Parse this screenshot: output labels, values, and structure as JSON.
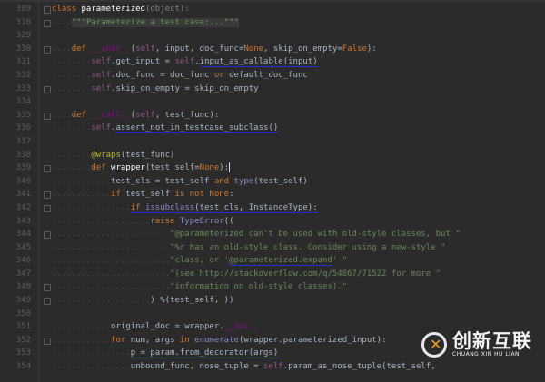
{
  "editor": {
    "lines": [
      {
        "n": "309",
        "indent": 0,
        "fold": true,
        "tokens": [
          [
            "k",
            "class "
          ],
          [
            "fn",
            "parameterized"
          ],
          [
            "c",
            "(object):"
          ]
        ]
      },
      {
        "n": "310",
        "indent": 4,
        "fold": true,
        "tokens": [
          [
            "doc",
            "\"\"\"Parameterize a test case:...\"\"\""
          ]
        ]
      },
      {
        "n": "329",
        "indent": 0,
        "tokens": []
      },
      {
        "n": "330",
        "indent": 4,
        "fold": true,
        "tokens": [
          [
            "k",
            "def "
          ],
          [
            "m",
            "__init__"
          ],
          [
            "n",
            "("
          ],
          [
            "s",
            "self"
          ],
          [
            "n",
            ", input, doc_func="
          ],
          [
            "k",
            "None"
          ],
          [
            "n",
            ", skip_on_empty="
          ],
          [
            "k",
            "False"
          ],
          [
            "n",
            "):"
          ]
        ]
      },
      {
        "n": "331",
        "indent": 8,
        "tokens": [
          [
            "s",
            "self"
          ],
          [
            "n",
            ".get_input = "
          ],
          [
            "s",
            "self"
          ],
          [
            "n",
            "."
          ],
          [
            "n ul",
            "input_as_callable(input)"
          ]
        ]
      },
      {
        "n": "332",
        "indent": 8,
        "tokens": [
          [
            "s",
            "self"
          ],
          [
            "n",
            ".doc_func = doc_func "
          ],
          [
            "k",
            "or"
          ],
          [
            "n",
            " default_doc_func"
          ]
        ]
      },
      {
        "n": "333",
        "indent": 8,
        "fold": true,
        "tokens": [
          [
            "s",
            "self"
          ],
          [
            "n",
            ".skip_on_empty = skip_on_empty"
          ]
        ]
      },
      {
        "n": "334",
        "indent": 0,
        "tokens": []
      },
      {
        "n": "335",
        "indent": 4,
        "fold": true,
        "tokens": [
          [
            "k",
            "def "
          ],
          [
            "m",
            "__call__"
          ],
          [
            "n",
            "("
          ],
          [
            "s",
            "self"
          ],
          [
            "n",
            ", test_func):"
          ]
        ]
      },
      {
        "n": "336",
        "indent": 8,
        "tokens": [
          [
            "s",
            "self"
          ],
          [
            "n",
            "."
          ],
          [
            "n ul",
            "assert_not_in_testcase_subclass()"
          ]
        ]
      },
      {
        "n": "337",
        "indent": 0,
        "tokens": []
      },
      {
        "n": "338",
        "indent": 8,
        "tokens": [
          [
            "d",
            "@wraps"
          ],
          [
            "n",
            "(test_func)"
          ]
        ]
      },
      {
        "n": "339",
        "indent": 8,
        "fold": true,
        "cursor": true,
        "tokens": [
          [
            "k",
            "def "
          ],
          [
            "fn",
            "wrapper"
          ],
          [
            "n",
            "(test_self="
          ],
          [
            "k",
            "None"
          ],
          [
            "n",
            "):"
          ]
        ]
      },
      {
        "n": "340",
        "indent": 12,
        "tokens": [
          [
            "n",
            "test_cls = test_self "
          ],
          [
            "k",
            "and "
          ],
          [
            "b",
            "type"
          ],
          [
            "n",
            "(test_self)"
          ]
        ]
      },
      {
        "n": "341",
        "indent": 12,
        "fold": true,
        "tokens": [
          [
            "k",
            "if "
          ],
          [
            "n",
            "test_self "
          ],
          [
            "k",
            "is not None"
          ],
          [
            "n",
            ":"
          ]
        ]
      },
      {
        "n": "342",
        "indent": 16,
        "fold": true,
        "tokens": [
          [
            "k ul",
            "if "
          ],
          [
            "b ul",
            "issubclass"
          ],
          [
            "n ul",
            "(test_cls, InstanceType):"
          ]
        ]
      },
      {
        "n": "343",
        "indent": 20,
        "tokens": [
          [
            "k",
            "raise "
          ],
          [
            "b",
            "TypeError"
          ],
          [
            "n",
            "(("
          ]
        ]
      },
      {
        "n": "344",
        "indent": 24,
        "fold": true,
        "tokens": [
          [
            "str",
            "\"@parameterized can't be used with old-style classes, but \""
          ]
        ]
      },
      {
        "n": "345",
        "indent": 24,
        "tokens": [
          [
            "str",
            "\"%r has an old-style class. Consider using a new-style \""
          ]
        ]
      },
      {
        "n": "346",
        "indent": 24,
        "tokens": [
          [
            "str",
            "\"class, or '"
          ],
          [
            "str ul",
            "@parameterized.expand"
          ],
          [
            "str",
            "' \""
          ]
        ]
      },
      {
        "n": "347",
        "indent": 24,
        "tokens": [
          [
            "str",
            "\"(see http://stackoverflow.com/q/54867/71522 for more \""
          ]
        ]
      },
      {
        "n": "348",
        "indent": 24,
        "fold": true,
        "tokens": [
          [
            "str",
            "\"information on old-style classes).\""
          ]
        ]
      },
      {
        "n": "349",
        "indent": 20,
        "fold": true,
        "tokens": [
          [
            "n",
            ") %(test_self, ))"
          ]
        ]
      },
      {
        "n": "350",
        "indent": 0,
        "tokens": []
      },
      {
        "n": "351",
        "indent": 12,
        "tokens": [
          [
            "n",
            "original_doc = wrapper."
          ],
          [
            "m",
            "__doc__"
          ]
        ]
      },
      {
        "n": "352",
        "indent": 12,
        "fold": true,
        "tokens": [
          [
            "k",
            "for "
          ],
          [
            "n",
            "num, args "
          ],
          [
            "k",
            "in "
          ],
          [
            "b",
            "enumerate"
          ],
          [
            "n",
            "(wrapper.parameterized_input):"
          ]
        ]
      },
      {
        "n": "353",
        "indent": 16,
        "tokens": [
          [
            "n ul",
            "p = param.from_decorator(args)"
          ]
        ]
      },
      {
        "n": "354",
        "indent": 16,
        "tokens": [
          [
            "n",
            "unbound_func, nose_tuple = "
          ],
          [
            "s",
            "self"
          ],
          [
            "n",
            ".param_as_nose_tuple(test_self,"
          ]
        ]
      }
    ]
  },
  "logo": {
    "cn": "创新互联",
    "en": "CHUANG XIN HU LIAN"
  }
}
